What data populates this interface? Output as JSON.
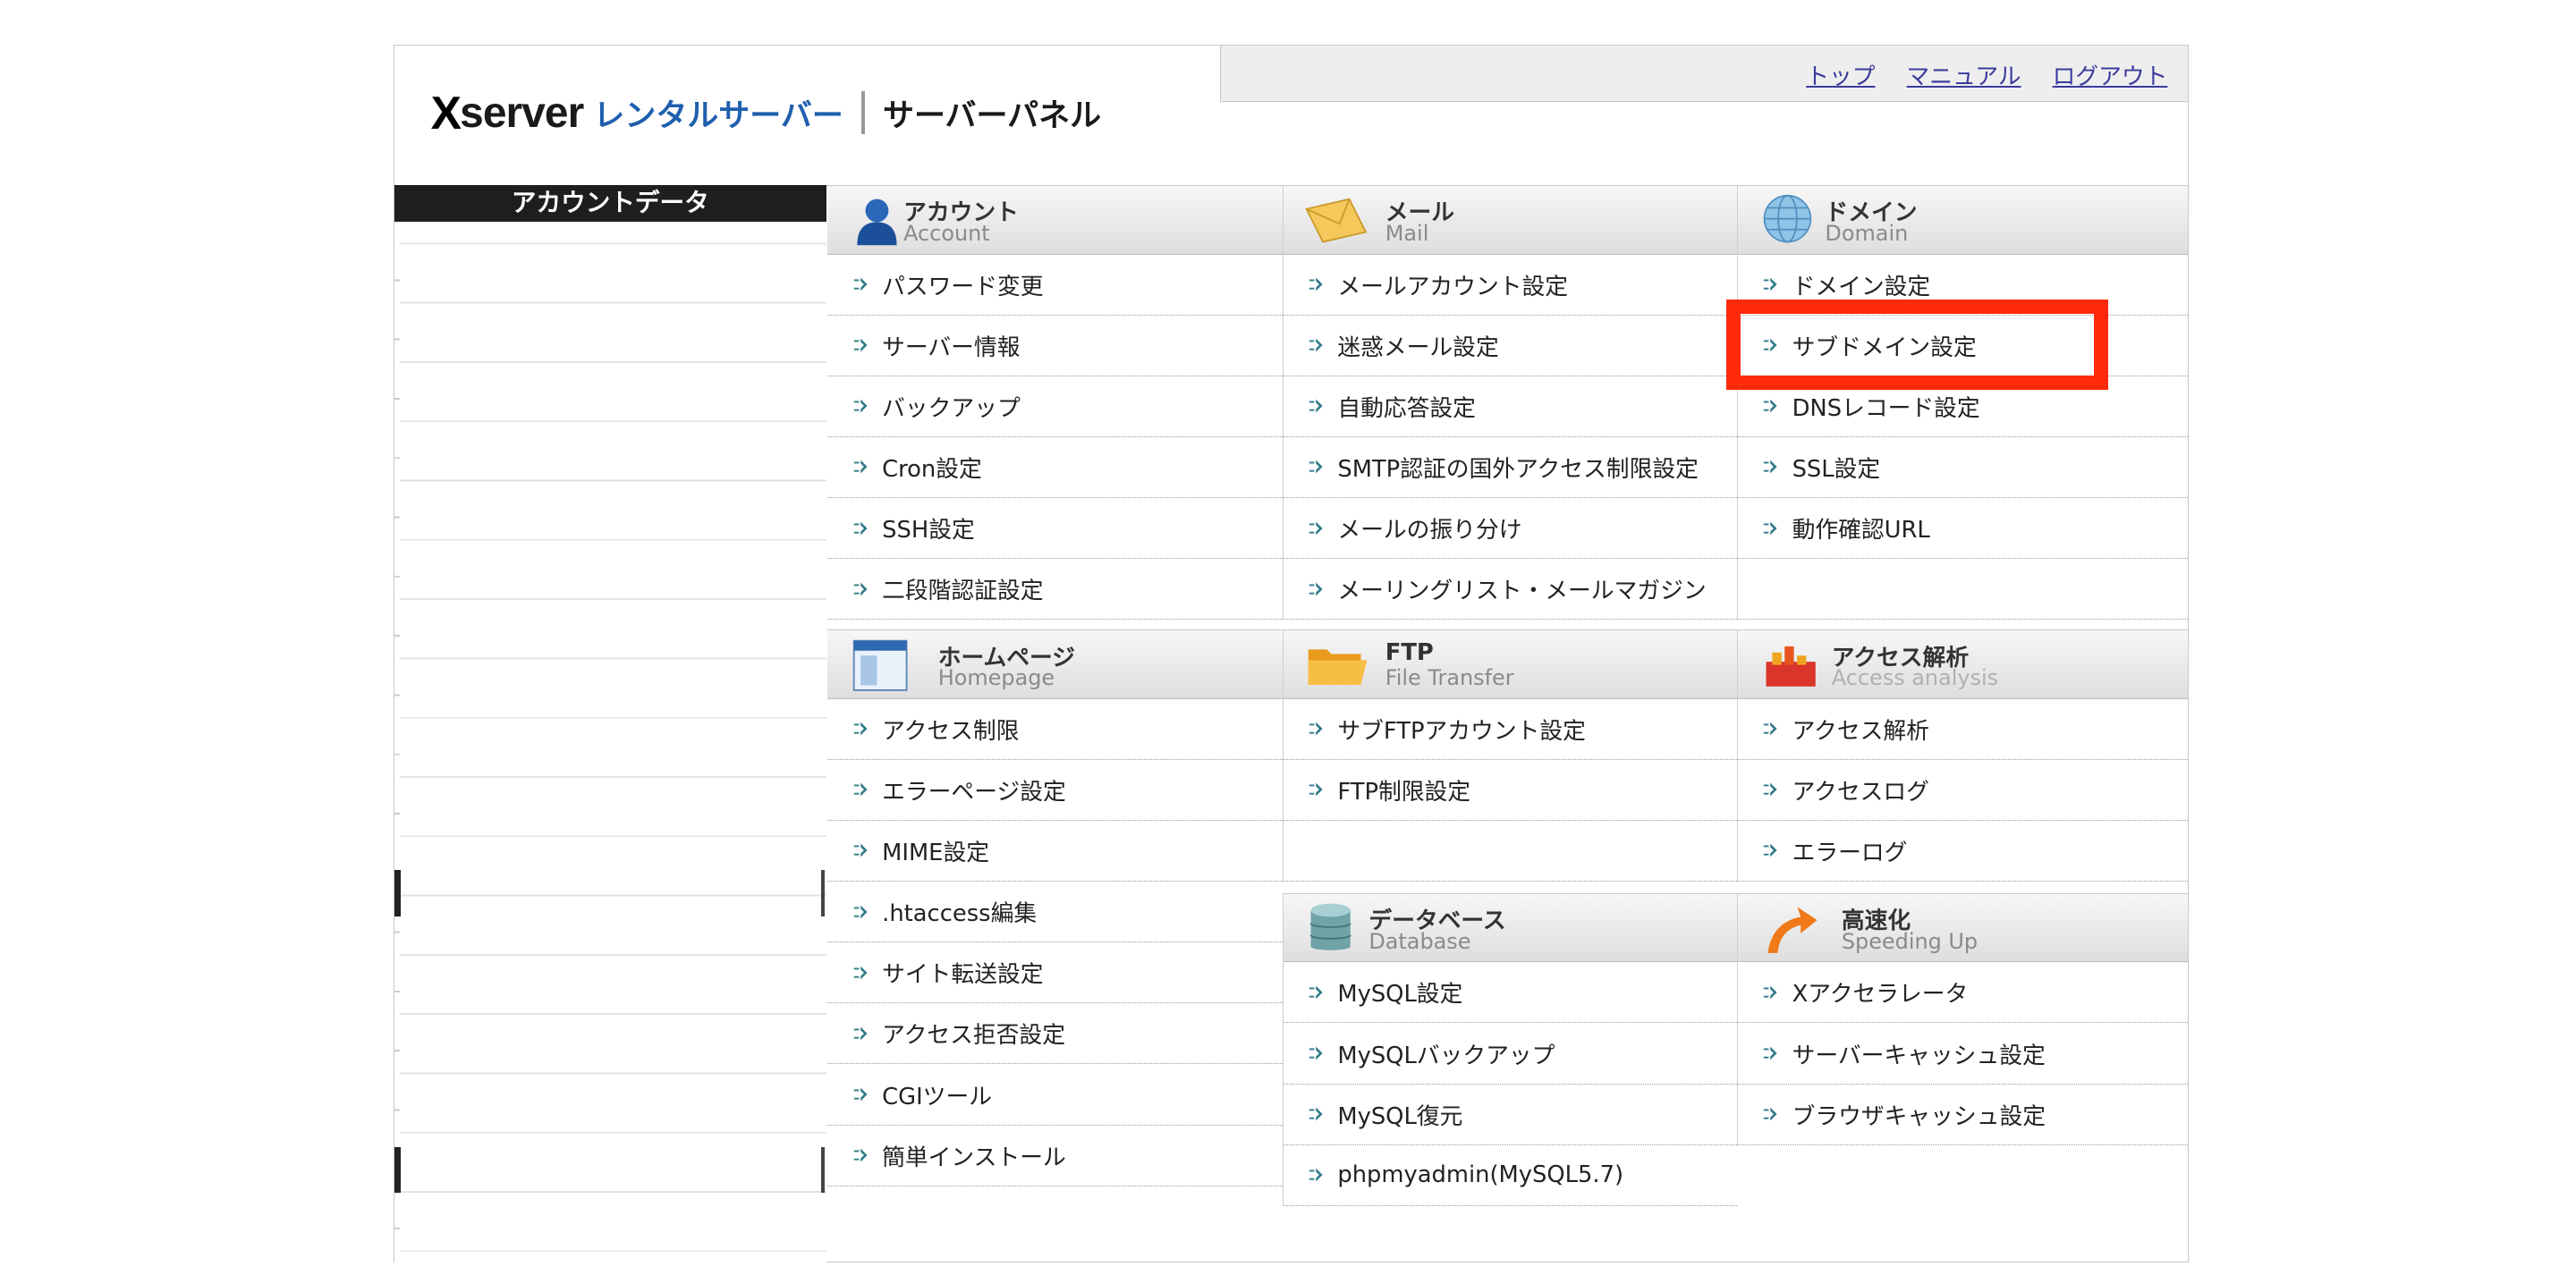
{
  "header": {
    "logo_x": "X",
    "logo_server": "server",
    "logo_rental": "レンタルサーバー",
    "logo_panel": "サーバーパネル",
    "links": [
      "トップ",
      "マニュアル",
      "ログアウト"
    ]
  },
  "sidebar": {
    "title": "アカウントデータ"
  },
  "sections": {
    "account": {
      "jp": "アカウント",
      "en": "Account",
      "items": [
        "パスワード変更",
        "サーバー情報",
        "バックアップ",
        "Cron設定",
        "SSH設定",
        "二段階認証設定"
      ]
    },
    "mail": {
      "jp": "メール",
      "en": "Mail",
      "items": [
        "メールアカウント設定",
        "迷惑メール設定",
        "自動応答設定",
        "SMTP認証の国外アクセス制限設定",
        "メールの振り分け",
        "メーリングリスト・メールマガジン"
      ]
    },
    "domain": {
      "jp": "ドメイン",
      "en": "Domain",
      "items": [
        "ドメイン設定",
        "サブドメイン設定",
        "DNSレコード設定",
        "SSL設定",
        "動作確認URL"
      ]
    },
    "homepage": {
      "jp": "ホームページ",
      "en": "Homepage",
      "items": [
        "アクセス制限",
        "エラーページ設定",
        "MIME設定",
        ".htaccess編集",
        "サイト転送設定",
        "アクセス拒否設定",
        "CGIツール",
        "簡単インストール"
      ]
    },
    "ftp": {
      "jp": "FTP",
      "en": "File Transfer",
      "items": [
        "サブFTPアカウント設定",
        "FTP制限設定"
      ]
    },
    "access": {
      "jp": "アクセス解析",
      "en": "Access analysis",
      "items": [
        "アクセス解析",
        "アクセスログ",
        "エラーログ"
      ]
    },
    "database": {
      "jp": "データベース",
      "en": "Database",
      "items": [
        "MySQL設定",
        "MySQLバックアップ",
        "MySQL復元",
        "phpmyadmin(MySQL5.7)"
      ]
    },
    "speed": {
      "jp": "高速化",
      "en": "Speeding Up",
      "items": [
        "Xアクセラレータ",
        "サーバーキャッシュ設定",
        "ブラウザキャッシュ設定"
      ]
    }
  },
  "colors": {
    "highlight": "#ff2a0a",
    "brand_blue": "#1f5fae",
    "link": "#3b3b9e"
  }
}
